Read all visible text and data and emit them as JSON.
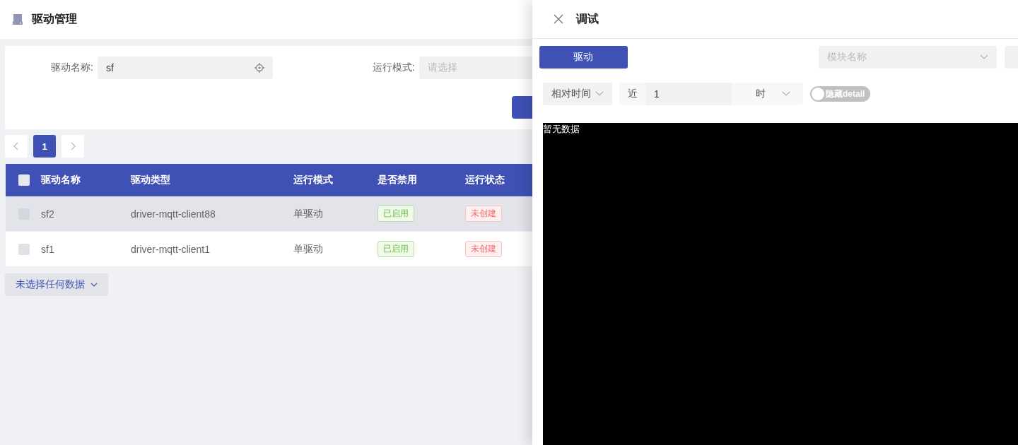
{
  "page": {
    "title": "驱动管理"
  },
  "filters": [
    {
      "label": "驱动名称:",
      "value": "sf"
    },
    {
      "label": "运行模式:",
      "placeholder": "请选择"
    }
  ],
  "pagination": {
    "pages": [
      {
        "label": "1",
        "selected": true
      }
    ]
  },
  "table": {
    "columns": [
      "驱动名称",
      "驱动类型",
      "运行模式",
      "是否禁用",
      "运行状态"
    ],
    "header_checked": false,
    "rows": [
      {
        "highlighted": true,
        "checked": false,
        "cells": [
          "sf2",
          "driver-mqtt-client88",
          "单驱动"
        ],
        "enabled": {
          "label": "已启用",
          "kind": "success"
        },
        "status": {
          "label": "未创建",
          "kind": "danger"
        }
      },
      {
        "highlighted": false,
        "checked": false,
        "cells": [
          "sf1",
          "driver-mqtt-client1",
          "单驱动"
        ],
        "enabled": {
          "label": "已启用",
          "kind": "success"
        },
        "status": {
          "label": "未创建",
          "kind": "danger"
        }
      }
    ]
  },
  "selection_dropdown": "未选择任何数据",
  "drawer": {
    "title": "调试",
    "primary_button": "驱动",
    "module_select": {
      "placeholder": "模块名称"
    },
    "time_mode": "相对时间",
    "recent_prefix": "近",
    "recent_value": "1",
    "unit": "时",
    "toggle": {
      "label": "隐藏detail",
      "on": false
    },
    "console_text": "暂无数据"
  }
}
